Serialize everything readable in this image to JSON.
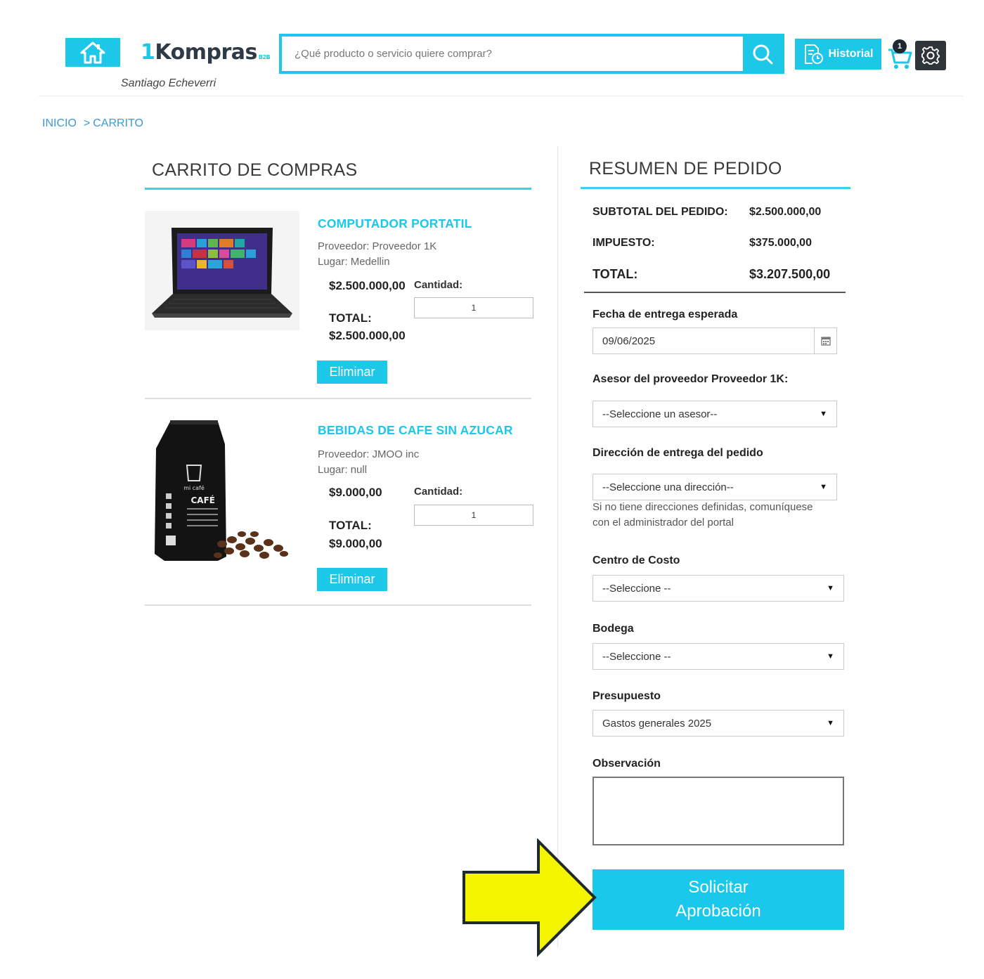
{
  "header": {
    "logo_prefix": "1",
    "logo_text": "Kompras",
    "logo_suffix": "B2B",
    "user_name": "Santiago Echeverri",
    "search_placeholder": "¿Qué producto o servicio quiere comprar?",
    "history_label": "Historial",
    "cart_count": "1",
    "icons": [
      "home-icon",
      "search-icon",
      "history-icon",
      "cart-icon",
      "gear-icon"
    ]
  },
  "breadcrumb": {
    "home": "INICIO",
    "separator": ">",
    "current": "CARRITO"
  },
  "cart": {
    "title": "CARRITO DE COMPRAS",
    "quantity_label": "Cantidad:",
    "total_label": "TOTAL:",
    "delete_label": "Eliminar",
    "items": [
      {
        "name": "COMPUTADOR PORTATIL",
        "provider": "Proveedor: Proveedor 1K",
        "place": "Lugar: Medellin",
        "price": "$2.500.000,00",
        "quantity": "1",
        "total": "$2.500.000,00"
      },
      {
        "name": "BEBIDAS DE CAFE SIN AZUCAR",
        "provider": "Proveedor: JMOO inc",
        "place": "Lugar: null",
        "price": "$9.000,00",
        "quantity": "1",
        "total": "$9.000,00"
      }
    ]
  },
  "summary": {
    "title": "RESUMEN DE PEDIDO",
    "subtotal_label": "SUBTOTAL DEL PEDIDO:",
    "subtotal_value": "$2.500.000,00",
    "tax_label": "IMPUESTO:",
    "tax_value": "$375.000,00",
    "total_label": "TOTAL:",
    "total_value": "$3.207.500,00",
    "delivery_date_label": "Fecha de entrega esperada",
    "delivery_date_value": "09/06/2025",
    "advisor_label": "Asesor del proveedor Proveedor 1K:",
    "advisor_value": "--Seleccione un asesor--",
    "address_label": "Dirección de entrega del pedido",
    "address_value": "--Seleccione una dirección--",
    "address_help": "Si no tiene direcciones definidas, comuníquese con el administrador del portal",
    "cost_center_label": "Centro de Costo",
    "cost_center_value": "--Seleccione --",
    "warehouse_label": "Bodega",
    "warehouse_value": "--Seleccione --",
    "budget_label": "Presupuesto",
    "budget_value": "Gastos generales 2025",
    "observation_label": "Observación",
    "observation_value": "",
    "submit_label": "Solicitar Aprobación"
  },
  "colors": {
    "accent": "#1cc7e8",
    "dark": "#2e3a45",
    "annotation_arrow": "#f5f500"
  }
}
